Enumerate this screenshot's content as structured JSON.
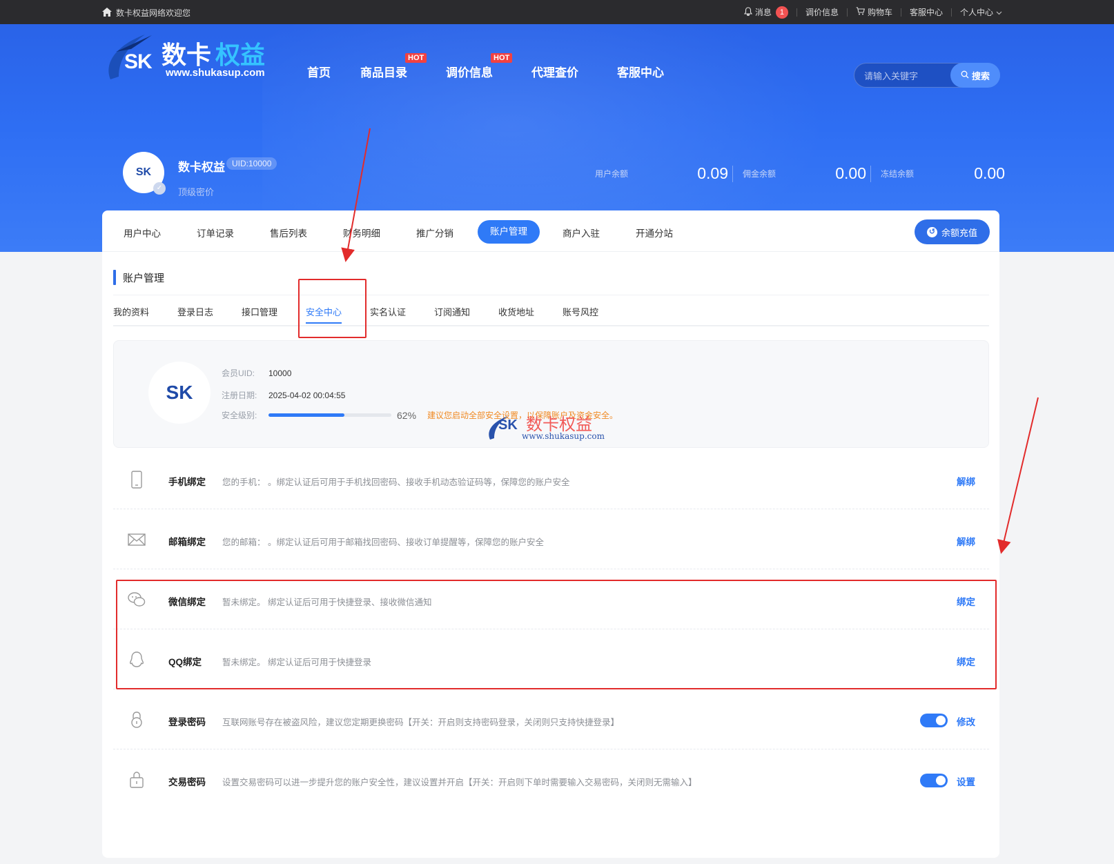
{
  "topbar": {
    "welcome": "数卡权益网络欢迎您",
    "messages": "消息",
    "message_count": "1",
    "price_info": "调价信息",
    "cart": "购物车",
    "service": "客服中心",
    "personal": "个人中心"
  },
  "logo": {
    "sk": "SK",
    "brand_part1": "数卡",
    "brand_part2": "权益",
    "url": "www.shukasup.com"
  },
  "nav": {
    "items": [
      {
        "label": "首页",
        "hot": ""
      },
      {
        "label": "商品目录",
        "hot": "HOT"
      },
      {
        "label": "调价信息",
        "hot": "HOT"
      },
      {
        "label": "代理查价",
        "hot": ""
      },
      {
        "label": "客服中心",
        "hot": ""
      }
    ]
  },
  "search": {
    "placeholder": "请输入关键字",
    "button": "搜索"
  },
  "profile": {
    "name": "数卡权益",
    "uid_badge": "UID:10000",
    "level": "顶级密价",
    "avatar_text": "SK"
  },
  "balances": [
    {
      "label": "用户余额",
      "value": "0.09"
    },
    {
      "label": "佣金余额",
      "value": "0.00"
    },
    {
      "label": "冻结余额",
      "value": "0.00"
    }
  ],
  "main_tabs": {
    "items": [
      "用户中心",
      "订单记录",
      "售后列表",
      "财务明细",
      "推广分销",
      "账户管理",
      "商户入驻",
      "开通分站"
    ],
    "active": "账户管理",
    "recharge": "余额充值"
  },
  "section": {
    "title": "账户管理"
  },
  "sub_tabs": {
    "items": [
      "我的资料",
      "登录日志",
      "接口管理",
      "安全中心",
      "实名认证",
      "订阅通知",
      "收货地址",
      "账号风控"
    ],
    "active": "安全中心"
  },
  "info": {
    "avatar_text": "SK",
    "uid_label": "会员UID:",
    "uid_value": "10000",
    "reg_label": "注册日期:",
    "reg_value": "2025-04-02 00:04:55",
    "level_label": "安全级别:",
    "level_pct": "62%",
    "level_fraction": 0.62,
    "warning": "建议您启动全部安全设置，以保障账户及资金安全。"
  },
  "watermark": {
    "brand": "数卡权益",
    "sk": "SK",
    "url": "www.shukasup.com"
  },
  "security_rows": [
    {
      "icon": "phone-icon",
      "title": "手机绑定",
      "desc": "您的手机：                     。绑定认证后可用于手机找回密码、接收手机动态验证码等，保障您的账户安全",
      "action": "解绑",
      "toggle": false
    },
    {
      "icon": "mail-icon",
      "title": "邮箱绑定",
      "desc": "您的邮箱：                                   。绑定认证后可用于邮箱找回密码、接收订单提醒等，保障您的账户安全",
      "action": "解绑",
      "toggle": false
    },
    {
      "icon": "wechat-icon",
      "title": "微信绑定",
      "desc": "暂未绑定。 绑定认证后可用于快捷登录、接收微信通知",
      "action": "绑定",
      "toggle": false
    },
    {
      "icon": "qq-icon",
      "title": "QQ绑定",
      "desc": "暂未绑定。 绑定认证后可用于快捷登录",
      "action": "绑定",
      "toggle": false
    },
    {
      "icon": "lock-icon",
      "title": "登录密码",
      "desc": "互联网账号存在被盗风险，建议您定期更换密码【开关：开启则支持密码登录，关闭则只支持快捷登录】",
      "action": "修改",
      "toggle": true
    },
    {
      "icon": "padlock-icon",
      "title": "交易密码",
      "desc": "设置交易密码可以进一步提升您的账户安全性，建议设置并开启【开关：开启则下单时需要输入交易密码，关闭则无需输入】",
      "action": "设置",
      "toggle": true
    }
  ],
  "colors": {
    "accent": "#2f7af7",
    "hero": "#2e6ef3",
    "warning": "#f08a24",
    "annotation": "#e22b2b"
  }
}
